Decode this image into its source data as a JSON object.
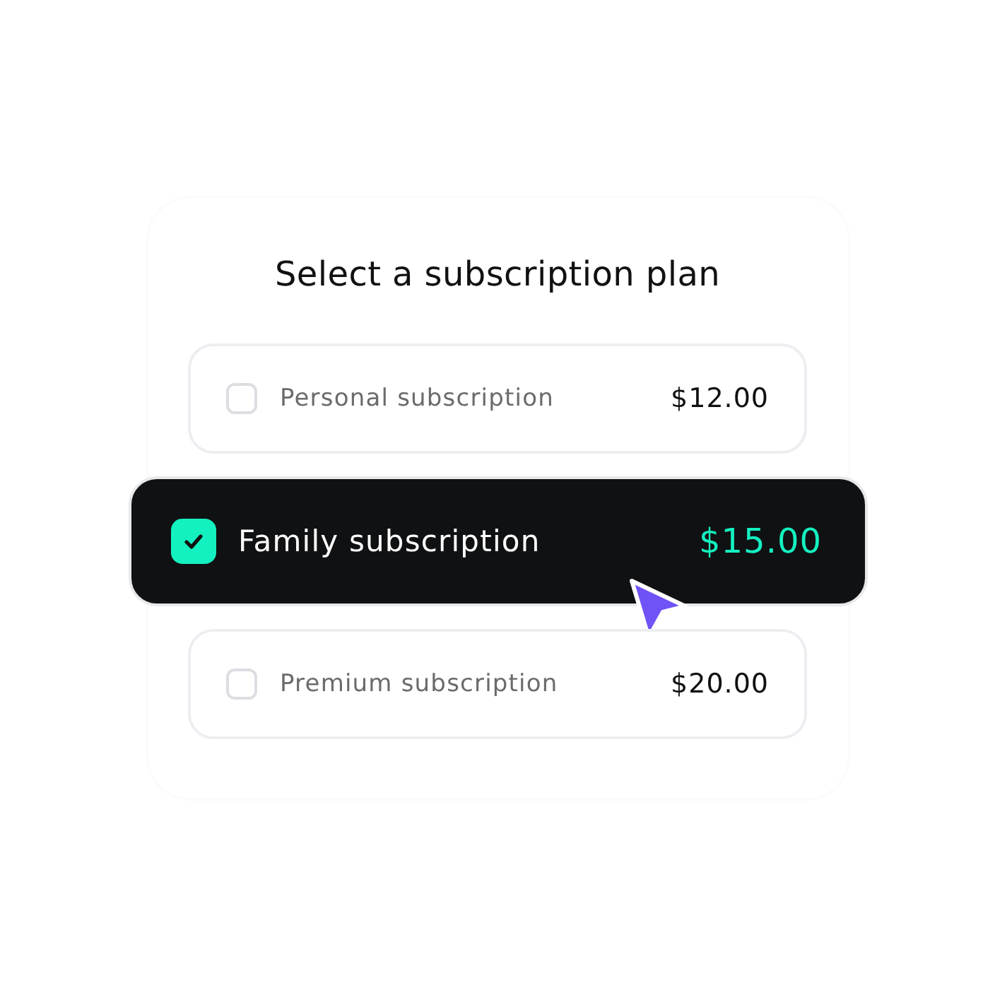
{
  "title": "Select a subscription plan",
  "plans": [
    {
      "name": "Personal subscription",
      "price": "$12.00",
      "selected": false
    },
    {
      "name": "Family subscription",
      "price": "$15.00",
      "selected": true
    },
    {
      "name": "Premium subscription",
      "price": "$20.00",
      "selected": false
    }
  ]
}
